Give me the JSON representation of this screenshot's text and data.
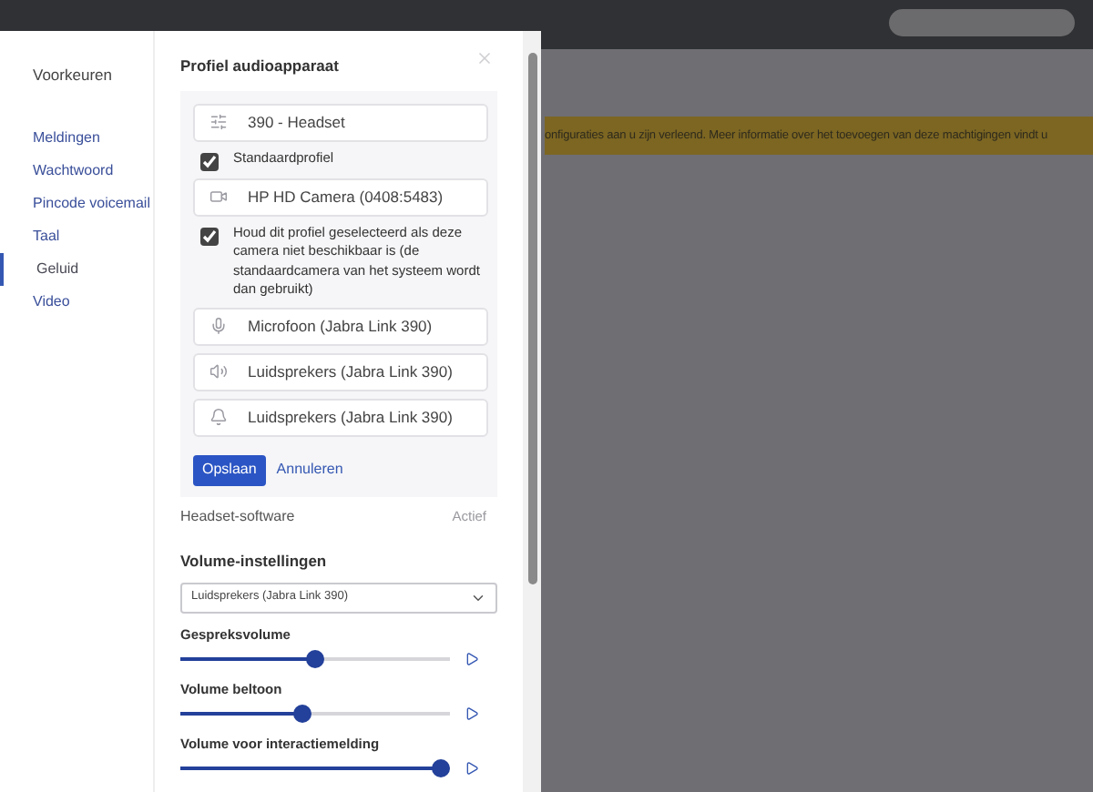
{
  "background": {
    "banner": "onfiguraties aan u zijn verleend. Meer informatie over het toevoegen van deze machtigingen vindt u"
  },
  "sidebar": {
    "heading": "Voorkeuren",
    "items": [
      {
        "label": "Meldingen",
        "selected": false
      },
      {
        "label": "Wachtwoord",
        "selected": false
      },
      {
        "label": "Pincode voicemail",
        "selected": false
      },
      {
        "label": "Taal",
        "selected": false
      },
      {
        "label": "Geluid",
        "selected": true
      },
      {
        "label": "Video",
        "selected": false
      }
    ]
  },
  "profile": {
    "title": "Profiel audioapparaat",
    "rows": [
      {
        "kind": "sliders",
        "value": "390 - Headset"
      },
      {
        "kind": "checkbox",
        "label": "Standaardprofiel",
        "checked": true
      },
      {
        "kind": "camera",
        "value": "HP HD Camera (0408:5483)"
      },
      {
        "kind": "checkbox",
        "label": "Houd dit profiel geselecteerd als deze camera niet beschikbaar is (de standaardcamera van het systeem wordt dan gebruikt)",
        "checked": true
      },
      {
        "kind": "mic",
        "value": "Microfoon (Jabra Link 390)"
      },
      {
        "kind": "speaker",
        "value": "Luidsprekers (Jabra Link 390)"
      },
      {
        "kind": "bell",
        "value": "Luidsprekers (Jabra Link 390)"
      }
    ],
    "save": "Opslaan",
    "cancel": "Annuleren"
  },
  "headset": {
    "label": "Headset-software",
    "status": "Actief",
    "disabled": true
  },
  "volume": {
    "title": "Volume-instellingen",
    "device": "Luidsprekers (Jabra Link 390)",
    "sliders": [
      {
        "label": "Gespreksvolume",
        "level": 0.52
      },
      {
        "label": "Volume beltoon",
        "level": 0.47
      },
      {
        "label": "Volume voor interactiemelding",
        "level": 1.0
      }
    ]
  }
}
